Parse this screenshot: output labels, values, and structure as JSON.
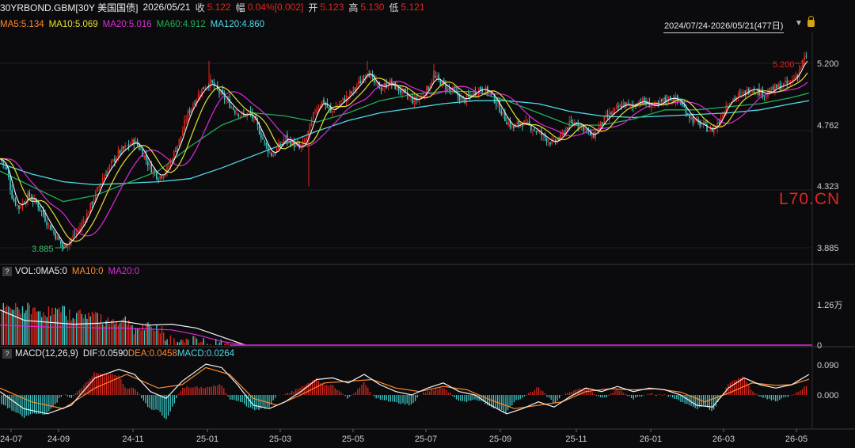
{
  "header": {
    "symbol": "30YRBOND.GBM[30Y 美国国债]",
    "date": "2026/05/21",
    "close_label": "收",
    "close": "5.122",
    "change_label": "幅",
    "change": "0.04%[0.002]",
    "open_label": "开",
    "open": "5.123",
    "high_label": "高",
    "high": "5.130",
    "low_label": "低",
    "low": "5.121"
  },
  "ma_legend": {
    "ma5": "MA5:5.134",
    "ma10": "MA10:5.069",
    "ma20": "MA20:5.016",
    "ma60": "MA60:4.912",
    "ma120": "MA120:4.860"
  },
  "range": {
    "text": "2024/07/24-2026/05/21(477日)",
    "arrow": "▼"
  },
  "watermark": "L70.CN",
  "volume_legend": {
    "help": "?",
    "vol": "VOL:0",
    "ma5": "MA5:0",
    "ma10": "MA10:0",
    "ma20": "MA20:0"
  },
  "macd_legend": {
    "help": "?",
    "title": "MACD(12,26,9)",
    "dif": "DIF:0.0590",
    "dea": "DEA:0.0458",
    "macd": "MACD:0.0264"
  },
  "colors": {
    "up": "#e0261d",
    "down": "#3ec8c6",
    "ma5": "#f5f5f5",
    "ma10": "#e5e02c",
    "ma20": "#dd2ad8",
    "ma60": "#1fae5a",
    "ma120": "#4fd9e6",
    "vol_ma10": "#ff8a2a",
    "dea": "#ff8a2a"
  },
  "chart_data": {
    "type": "candlestick",
    "price_axis": {
      "ticks": [
        "5.200",
        "4.762",
        "4.323",
        "3.885"
      ],
      "ylim": [
        3.8,
        5.28
      ]
    },
    "volume_axis": {
      "ticks": [
        "1.26万",
        "0"
      ]
    },
    "macd_axis": {
      "ticks": [
        "0.090",
        "0.000"
      ]
    },
    "x_ticks": [
      "24-07",
      "24-09",
      "24-11",
      "25-01",
      "25-03",
      "25-05",
      "25-07",
      "25-09",
      "25-11",
      "26-01",
      "26-03",
      "26-05"
    ],
    "annotations": {
      "max": "5.200",
      "min": "3.885"
    },
    "price_path": [
      [
        0,
        4.48
      ],
      [
        8,
        4.42
      ],
      [
        16,
        4.22
      ],
      [
        24,
        4.16
      ],
      [
        36,
        4.24
      ],
      [
        48,
        4.18
      ],
      [
        60,
        4.06
      ],
      [
        70,
        3.98
      ],
      [
        80,
        3.9
      ],
      [
        90,
        3.96
      ],
      [
        100,
        4.02
      ],
      [
        110,
        4.12
      ],
      [
        120,
        4.24
      ],
      [
        130,
        4.36
      ],
      [
        140,
        4.44
      ],
      [
        150,
        4.52
      ],
      [
        160,
        4.56
      ],
      [
        170,
        4.6
      ],
      [
        180,
        4.52
      ],
      [
        190,
        4.42
      ],
      [
        200,
        4.36
      ],
      [
        210,
        4.4
      ],
      [
        220,
        4.52
      ],
      [
        228,
        4.62
      ],
      [
        236,
        4.76
      ],
      [
        246,
        4.86
      ],
      [
        256,
        4.94
      ],
      [
        266,
        4.98
      ],
      [
        276,
        4.92
      ],
      [
        286,
        4.86
      ],
      [
        296,
        4.8
      ],
      [
        306,
        4.76
      ],
      [
        316,
        4.78
      ],
      [
        326,
        4.68
      ],
      [
        336,
        4.56
      ],
      [
        344,
        4.5
      ],
      [
        352,
        4.56
      ],
      [
        360,
        4.62
      ],
      [
        370,
        4.58
      ],
      [
        380,
        4.54
      ],
      [
        390,
        4.66
      ],
      [
        398,
        4.8
      ],
      [
        408,
        4.86
      ],
      [
        418,
        4.78
      ],
      [
        428,
        4.84
      ],
      [
        438,
        4.88
      ],
      [
        448,
        4.94
      ],
      [
        456,
        4.99
      ],
      [
        464,
        5.06
      ],
      [
        472,
        4.98
      ],
      [
        482,
        4.94
      ],
      [
        492,
        4.98
      ],
      [
        502,
        4.94
      ],
      [
        512,
        4.9
      ],
      [
        522,
        4.86
      ],
      [
        532,
        4.88
      ],
      [
        540,
        4.94
      ],
      [
        548,
        5.02
      ],
      [
        556,
        4.98
      ],
      [
        566,
        4.94
      ],
      [
        576,
        4.9
      ],
      [
        586,
        4.86
      ],
      [
        596,
        4.9
      ],
      [
        606,
        4.94
      ],
      [
        618,
        4.92
      ],
      [
        628,
        4.84
      ],
      [
        638,
        4.74
      ],
      [
        648,
        4.68
      ],
      [
        658,
        4.72
      ],
      [
        668,
        4.7
      ],
      [
        678,
        4.66
      ],
      [
        688,
        4.62
      ],
      [
        698,
        4.58
      ],
      [
        708,
        4.62
      ],
      [
        718,
        4.7
      ],
      [
        728,
        4.72
      ],
      [
        738,
        4.68
      ],
      [
        748,
        4.62
      ],
      [
        758,
        4.7
      ],
      [
        768,
        4.76
      ],
      [
        778,
        4.8
      ],
      [
        788,
        4.84
      ],
      [
        798,
        4.82
      ],
      [
        808,
        4.86
      ],
      [
        818,
        4.84
      ],
      [
        828,
        4.82
      ],
      [
        838,
        4.86
      ],
      [
        848,
        4.88
      ],
      [
        858,
        4.86
      ],
      [
        868,
        4.78
      ],
      [
        878,
        4.72
      ],
      [
        888,
        4.7
      ],
      [
        898,
        4.66
      ],
      [
        908,
        4.72
      ],
      [
        918,
        4.84
      ],
      [
        928,
        4.88
      ],
      [
        938,
        4.9
      ],
      [
        948,
        4.94
      ],
      [
        958,
        4.92
      ],
      [
        968,
        4.9
      ],
      [
        978,
        4.94
      ],
      [
        988,
        4.96
      ],
      [
        998,
        4.98
      ],
      [
        1008,
        5.04
      ],
      [
        1016,
        5.14
      ],
      [
        1022,
        5.12
      ]
    ],
    "ma120_path": [
      [
        0,
        4.45
      ],
      [
        40,
        4.38
      ],
      [
        80,
        4.33
      ],
      [
        120,
        4.31
      ],
      [
        160,
        4.32
      ],
      [
        200,
        4.33
      ],
      [
        240,
        4.35
      ],
      [
        280,
        4.42
      ],
      [
        320,
        4.5
      ],
      [
        360,
        4.58
      ],
      [
        400,
        4.66
      ],
      [
        440,
        4.73
      ],
      [
        480,
        4.78
      ],
      [
        520,
        4.81
      ],
      [
        560,
        4.84
      ],
      [
        600,
        4.86
      ],
      [
        640,
        4.86
      ],
      [
        680,
        4.84
      ],
      [
        720,
        4.79
      ],
      [
        760,
        4.76
      ],
      [
        800,
        4.75
      ],
      [
        840,
        4.76
      ],
      [
        880,
        4.77
      ],
      [
        920,
        4.78
      ],
      [
        960,
        4.8
      ],
      [
        1000,
        4.84
      ],
      [
        1022,
        4.86
      ]
    ],
    "ma60_path": [
      [
        0,
        4.4
      ],
      [
        40,
        4.3
      ],
      [
        80,
        4.2
      ],
      [
        120,
        4.24
      ],
      [
        160,
        4.32
      ],
      [
        200,
        4.4
      ],
      [
        240,
        4.56
      ],
      [
        280,
        4.7
      ],
      [
        320,
        4.78
      ],
      [
        360,
        4.76
      ],
      [
        400,
        4.72
      ],
      [
        440,
        4.78
      ],
      [
        480,
        4.86
      ],
      [
        520,
        4.9
      ],
      [
        560,
        4.92
      ],
      [
        600,
        4.92
      ],
      [
        640,
        4.86
      ],
      [
        680,
        4.78
      ],
      [
        720,
        4.7
      ],
      [
        760,
        4.7
      ],
      [
        800,
        4.74
      ],
      [
        840,
        4.8
      ],
      [
        880,
        4.8
      ],
      [
        920,
        4.82
      ],
      [
        960,
        4.84
      ],
      [
        1000,
        4.88
      ],
      [
        1022,
        4.91
      ]
    ],
    "volume_heights": [
      0.72,
      0.66,
      0.6,
      0.48,
      0.32,
      0.06,
      0.0
    ],
    "volume_ma5": [
      0.74,
      0.52,
      0.48,
      0.44,
      0.46,
      0.5,
      0.42,
      0.44,
      0.36,
      0.18,
      0.0
    ],
    "volume_ma20": [
      0.42,
      0.4,
      0.38,
      0.38,
      0.36,
      0.36,
      0.34,
      0.32,
      0.22,
      0.08,
      0.0
    ],
    "macd_path": [
      [
        0,
        0.01
      ],
      [
        30,
        -0.04
      ],
      [
        60,
        -0.055
      ],
      [
        90,
        -0.03
      ],
      [
        120,
        0.05
      ],
      [
        150,
        0.075
      ],
      [
        170,
        0.06
      ],
      [
        190,
        0.01
      ],
      [
        210,
        -0.01
      ],
      [
        230,
        0.04
      ],
      [
        260,
        0.09
      ],
      [
        280,
        0.08
      ],
      [
        300,
        0.03
      ],
      [
        320,
        -0.03
      ],
      [
        340,
        -0.04
      ],
      [
        360,
        -0.02
      ],
      [
        380,
        0.01
      ],
      [
        400,
        0.045
      ],
      [
        420,
        0.05
      ],
      [
        440,
        0.035
      ],
      [
        460,
        0.06
      ],
      [
        480,
        0.03
      ],
      [
        500,
        0.01
      ],
      [
        520,
        0.0
      ],
      [
        540,
        0.02
      ],
      [
        560,
        0.035
      ],
      [
        580,
        0.01
      ],
      [
        600,
        0.0
      ],
      [
        620,
        -0.03
      ],
      [
        640,
        -0.055
      ],
      [
        660,
        -0.04
      ],
      [
        680,
        -0.02
      ],
      [
        700,
        -0.035
      ],
      [
        720,
        -0.005
      ],
      [
        740,
        0.02
      ],
      [
        760,
        0.01
      ],
      [
        780,
        0.025
      ],
      [
        800,
        0.01
      ],
      [
        820,
        0.02
      ],
      [
        840,
        0.015
      ],
      [
        860,
        0.0
      ],
      [
        880,
        -0.03
      ],
      [
        900,
        -0.035
      ],
      [
        920,
        0.02
      ],
      [
        940,
        0.05
      ],
      [
        960,
        0.03
      ],
      [
        980,
        0.02
      ],
      [
        1000,
        0.03
      ],
      [
        1022,
        0.06
      ]
    ],
    "dea_path": [
      [
        0,
        0.02
      ],
      [
        40,
        -0.02
      ],
      [
        80,
        -0.04
      ],
      [
        120,
        0.02
      ],
      [
        160,
        0.06
      ],
      [
        200,
        0.02
      ],
      [
        230,
        0.03
      ],
      [
        260,
        0.08
      ],
      [
        290,
        0.06
      ],
      [
        320,
        -0.01
      ],
      [
        350,
        -0.03
      ],
      [
        380,
        0.0
      ],
      [
        410,
        0.035
      ],
      [
        440,
        0.04
      ],
      [
        470,
        0.045
      ],
      [
        500,
        0.02
      ],
      [
        530,
        0.01
      ],
      [
        560,
        0.025
      ],
      [
        590,
        0.015
      ],
      [
        620,
        -0.015
      ],
      [
        650,
        -0.04
      ],
      [
        680,
        -0.03
      ],
      [
        710,
        -0.02
      ],
      [
        740,
        0.01
      ],
      [
        770,
        0.018
      ],
      [
        800,
        0.015
      ],
      [
        830,
        0.018
      ],
      [
        860,
        0.008
      ],
      [
        890,
        -0.02
      ],
      [
        920,
        0.005
      ],
      [
        950,
        0.035
      ],
      [
        980,
        0.028
      ],
      [
        1000,
        0.03
      ],
      [
        1022,
        0.046
      ]
    ]
  }
}
